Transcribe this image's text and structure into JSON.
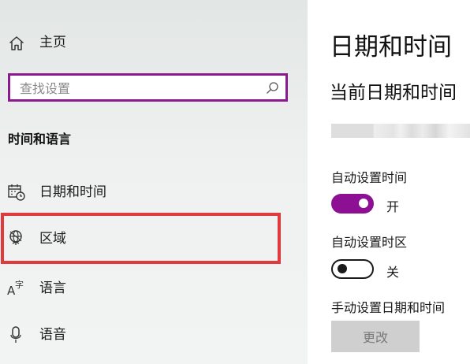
{
  "sidebar": {
    "home_label": "主页",
    "search": {
      "placeholder": "查找设置",
      "icon": "search-icon"
    },
    "section_heading": "时间和语言",
    "items": [
      {
        "label": "日期和时间",
        "icon": "calendar-clock-icon"
      },
      {
        "label": "区域",
        "icon": "globe-icon",
        "highlighted": true
      },
      {
        "label": "语言",
        "icon": "language-icon"
      },
      {
        "label": "语音",
        "icon": "microphone-icon"
      }
    ],
    "highlight_color": "#e0393e",
    "accent": "#8a1a8e"
  },
  "main": {
    "title": "日期和时间",
    "subtitle": "当前日期和时间",
    "settings": {
      "auto_time": {
        "label": "自动设置时间",
        "state_label": "开",
        "on": true
      },
      "auto_timezone": {
        "label": "自动设置时区",
        "state_label": "关",
        "on": false
      },
      "manual": {
        "label": "手动设置日期和时间",
        "button_label": "更改"
      }
    },
    "toggle_on_color": "#8d0f93"
  }
}
